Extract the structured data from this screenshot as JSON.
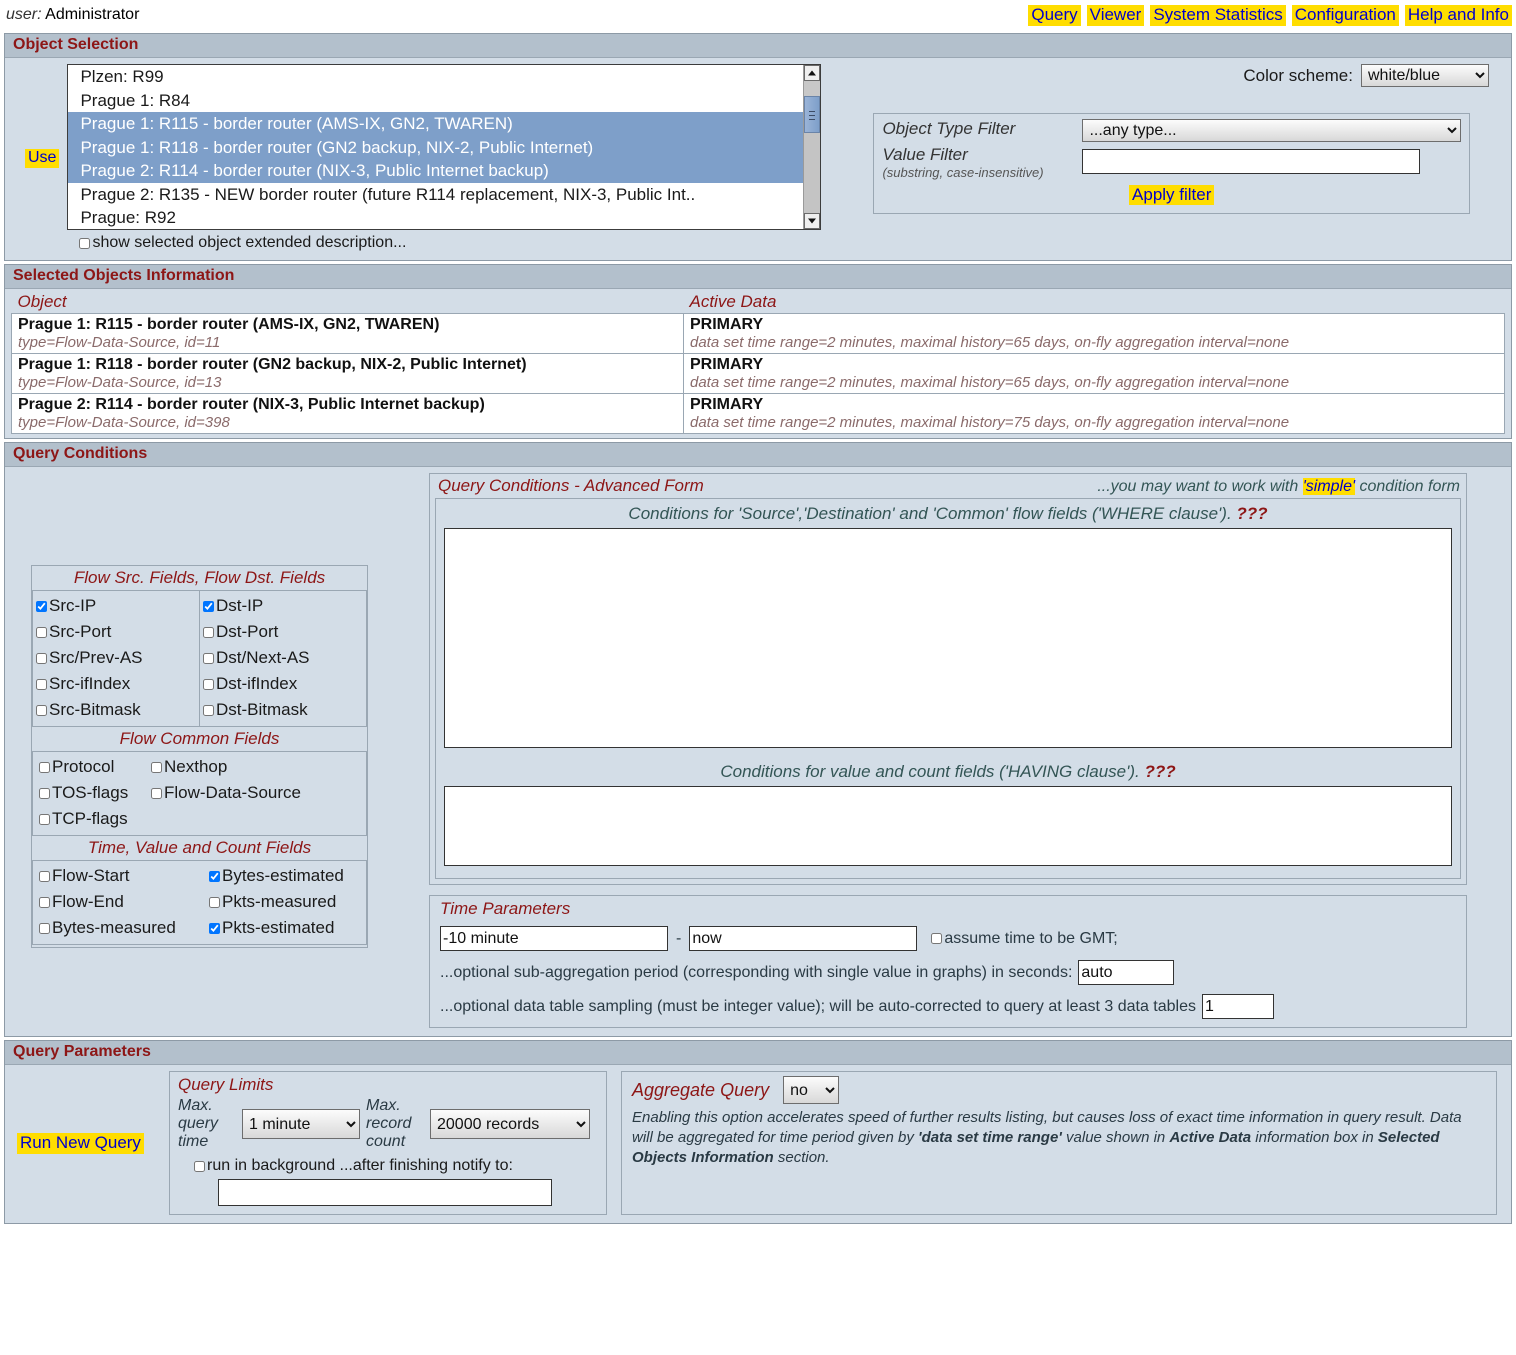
{
  "topbar": {
    "user_label": "user:",
    "user_name": "Administrator",
    "nav": [
      {
        "label": "Query"
      },
      {
        "label": "Viewer"
      },
      {
        "label": "System Statistics"
      },
      {
        "label": "Configuration"
      },
      {
        "label": "Help and Info"
      }
    ]
  },
  "object_selection": {
    "title": "Object Selection",
    "use_button": "Use",
    "list_items": [
      {
        "label": "Plzen: R99",
        "selected": false
      },
      {
        "label": "Prague 1: R84",
        "selected": false
      },
      {
        "label": "Prague 1: R115 - border router (AMS-IX, GN2, TWAREN)",
        "selected": true
      },
      {
        "label": "Prague 1: R118 - border router (GN2 backup, NIX-2, Public Internet)",
        "selected": true
      },
      {
        "label": "Prague 2: R114 - border router (NIX-3, Public Internet backup)",
        "selected": true
      },
      {
        "label": "Prague 2: R135 - NEW border router (future R114 replacement, NIX-3, Public Int..",
        "selected": false
      },
      {
        "label": "Prague: R92",
        "selected": false
      }
    ],
    "show_description_label": "show selected object extended description...",
    "color_scheme_label": "Color scheme:",
    "color_scheme_value": "white/blue",
    "object_type_filter_label": "Object Type Filter",
    "object_type_filter_value": "...any type...",
    "value_filter_label": "Value Filter",
    "value_filter_sub": "(substring, case-insensitive)",
    "value_filter_value": "",
    "apply_filter": "Apply filter"
  },
  "selected_objects": {
    "title": "Selected Objects Information",
    "columns": [
      "Object",
      "Active Data"
    ],
    "rows": [
      {
        "name": "Prague 1: R115 - border router (AMS-IX, GN2, TWAREN)",
        "meta": "type=Flow-Data-Source, id=11",
        "active": "PRIMARY",
        "active_meta": "data set time range=2 minutes, maximal history=65 days, on-fly aggregation interval=none"
      },
      {
        "name": "Prague 1: R118 - border router (GN2 backup, NIX-2, Public Internet)",
        "meta": "type=Flow-Data-Source, id=13",
        "active": "PRIMARY",
        "active_meta": "data set time range=2 minutes, maximal history=65 days, on-fly aggregation interval=none"
      },
      {
        "name": "Prague 2: R114 - border router (NIX-3, Public Internet backup)",
        "meta": "type=Flow-Data-Source, id=398",
        "active": "PRIMARY",
        "active_meta": "data set time range=2 minutes, maximal history=75 days, on-fly aggregation interval=none"
      }
    ]
  },
  "query_conditions": {
    "title": "Query Conditions",
    "src_dst_title_a": "Flow Src. Fields",
    "src_dst_title_b": "Flow Dst. Fields",
    "src_fields": [
      {
        "label": "Src-IP",
        "checked": true
      },
      {
        "label": "Src-Port",
        "checked": false
      },
      {
        "label": "Src/Prev-AS",
        "checked": false
      },
      {
        "label": "Src-ifIndex",
        "checked": false
      },
      {
        "label": "Src-Bitmask",
        "checked": false
      }
    ],
    "dst_fields": [
      {
        "label": "Dst-IP",
        "checked": true
      },
      {
        "label": "Dst-Port",
        "checked": false
      },
      {
        "label": "Dst/Next-AS",
        "checked": false
      },
      {
        "label": "Dst-ifIndex",
        "checked": false
      },
      {
        "label": "Dst-Bitmask",
        "checked": false
      }
    ],
    "common_title": "Flow Common Fields",
    "common_fields": [
      {
        "label": "Protocol",
        "checked": false
      },
      {
        "label": "Nexthop",
        "checked": false
      },
      {
        "label": "TOS-flags",
        "checked": false
      },
      {
        "label": "Flow-Data-Source",
        "checked": false
      },
      {
        "label": "TCP-flags",
        "checked": false
      }
    ],
    "time_value_title": "Time, Value and Count Fields",
    "time_value_fields": [
      {
        "label": "Flow-Start",
        "checked": false
      },
      {
        "label": "Bytes-estimated",
        "checked": true
      },
      {
        "label": "Flow-End",
        "checked": false
      },
      {
        "label": "Pkts-measured",
        "checked": false
      },
      {
        "label": "Bytes-measured",
        "checked": false
      },
      {
        "label": "Pkts-estimated",
        "checked": true
      }
    ],
    "advanced_title": "Query Conditions - Advanced Form",
    "advanced_hint_pre": "...you may want to work with ",
    "advanced_hint_link": "'simple'",
    "advanced_hint_post": " condition form",
    "where_title": "Conditions for 'Source','Destination' and 'Common' flow fields ('WHERE clause'). ",
    "where_qmarks": "???",
    "where_value": "",
    "having_title": "Conditions for value and count fields ('HAVING clause'). ",
    "having_qmarks": "???",
    "having_value": "",
    "time_params_title": "Time Parameters",
    "time_from": "-10 minute",
    "time_dash": "-",
    "time_to": "now",
    "gmt_label": "assume time to be GMT;",
    "subagg_label": "...optional sub-aggregation period (corresponding with single value in graphs) in seconds:",
    "subagg_value": "auto",
    "sampling_label": "...optional data table sampling (must be integer value); will be auto-corrected to query at least 3 data tables",
    "sampling_value": "1"
  },
  "query_parameters": {
    "title": "Query Parameters",
    "run_button": "Run New Query",
    "limits_title": "Query Limits",
    "max_query_time_label": "Max. query time",
    "max_query_time_value": "1 minute",
    "max_record_count_label": "Max. record count",
    "max_record_count_value": "20000 records",
    "background_label": "run in background ...after finishing notify to:",
    "notify_value": "",
    "aggregate_title": "Aggregate Query",
    "aggregate_value": "no",
    "aggregate_desc_1": "Enabling this option accelerates speed of further results listing, but causes loss of exact time information in query result. Data will be aggregated for time period given by ",
    "aggregate_desc_b1": "'data set time range'",
    "aggregate_desc_2": " value shown in ",
    "aggregate_desc_b2": "Active Data",
    "aggregate_desc_3": " information box in ",
    "aggregate_desc_b3": "Selected Objects Information",
    "aggregate_desc_4": " section."
  },
  "colors": {
    "accent_yellow": "#ffdd00",
    "link_blue": "#0000cc",
    "header_red": "#8d1616",
    "panel_bg": "#d3dde7",
    "panel_head_bg": "#b3c0cc",
    "selection_blue": "#7e9fc9"
  }
}
